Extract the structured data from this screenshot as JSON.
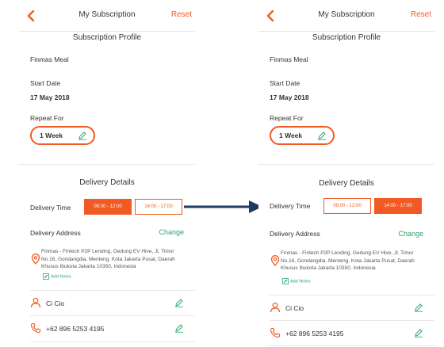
{
  "left_screen": {
    "header": {
      "title": "My Subscription",
      "reset_label": "Reset"
    },
    "profile": {
      "section_title": "Subscription Profile",
      "plan_name": "Finmas Meal",
      "start_date_label": "Start Date",
      "start_date_value": "17 May 2018",
      "repeat_label": "Repeat For",
      "repeat_value": "1 Week"
    },
    "delivery": {
      "section_title": "Delivery Details",
      "time_label": "Delivery Time",
      "slots": [
        {
          "label": "09:00 - 12:00",
          "selected": true
        },
        {
          "label": "14:00 - 17:00",
          "selected": false
        }
      ],
      "address_label": "Delivery Address",
      "change_label": "Change",
      "address_text": "Finmas - Fintech P2P Lending, Gedung EV Hive, Jl. Timor No.16, Gondangdia, Menteng, Kota Jakarta Pusat, Daerah Khusus Ibukota Jakarta 10350, Indonesia",
      "add_notes_label": "Add Notes",
      "recipient_name": "Ci Cio",
      "phone": "+62 896 5253 4195"
    }
  },
  "right_screen": {
    "header": {
      "title": "My Subscription",
      "reset_label": "Reset"
    },
    "profile": {
      "section_title": "Subscription Profile",
      "plan_name": "Finmas Meal",
      "start_date_label": "Start Date",
      "start_date_value": "17 May 2018",
      "repeat_label": "Repeat For",
      "repeat_value": "1 Week"
    },
    "delivery": {
      "section_title": "Delivery Details",
      "time_label": "Delivery Time",
      "slots": [
        {
          "label": "09:00 - 12:00",
          "selected": false
        },
        {
          "label": "14:00 - 17:00",
          "selected": true
        }
      ],
      "address_label": "Delivery Address",
      "change_label": "Change",
      "address_text": "Finmas - Fintech P2P Lending, Gedung EV Hive, Jl. Timor No.16, Gondangdia, Menteng, Kota Jakarta Pusat, Daerah Khusus Ibukota Jakarta 10350, Indonesia",
      "add_notes_label": "Add Notes",
      "recipient_name": "Ci Cio",
      "phone": "+62 896 5253 4195"
    }
  },
  "colors": {
    "accent": "#f15a22",
    "green": "#2ea56b",
    "arrow": "#1f3a5f"
  },
  "icons": [
    "chevron-left-icon",
    "pencil-icon",
    "location-pin-icon",
    "notes-icon",
    "person-icon",
    "phone-icon",
    "arrow-right-icon"
  ]
}
